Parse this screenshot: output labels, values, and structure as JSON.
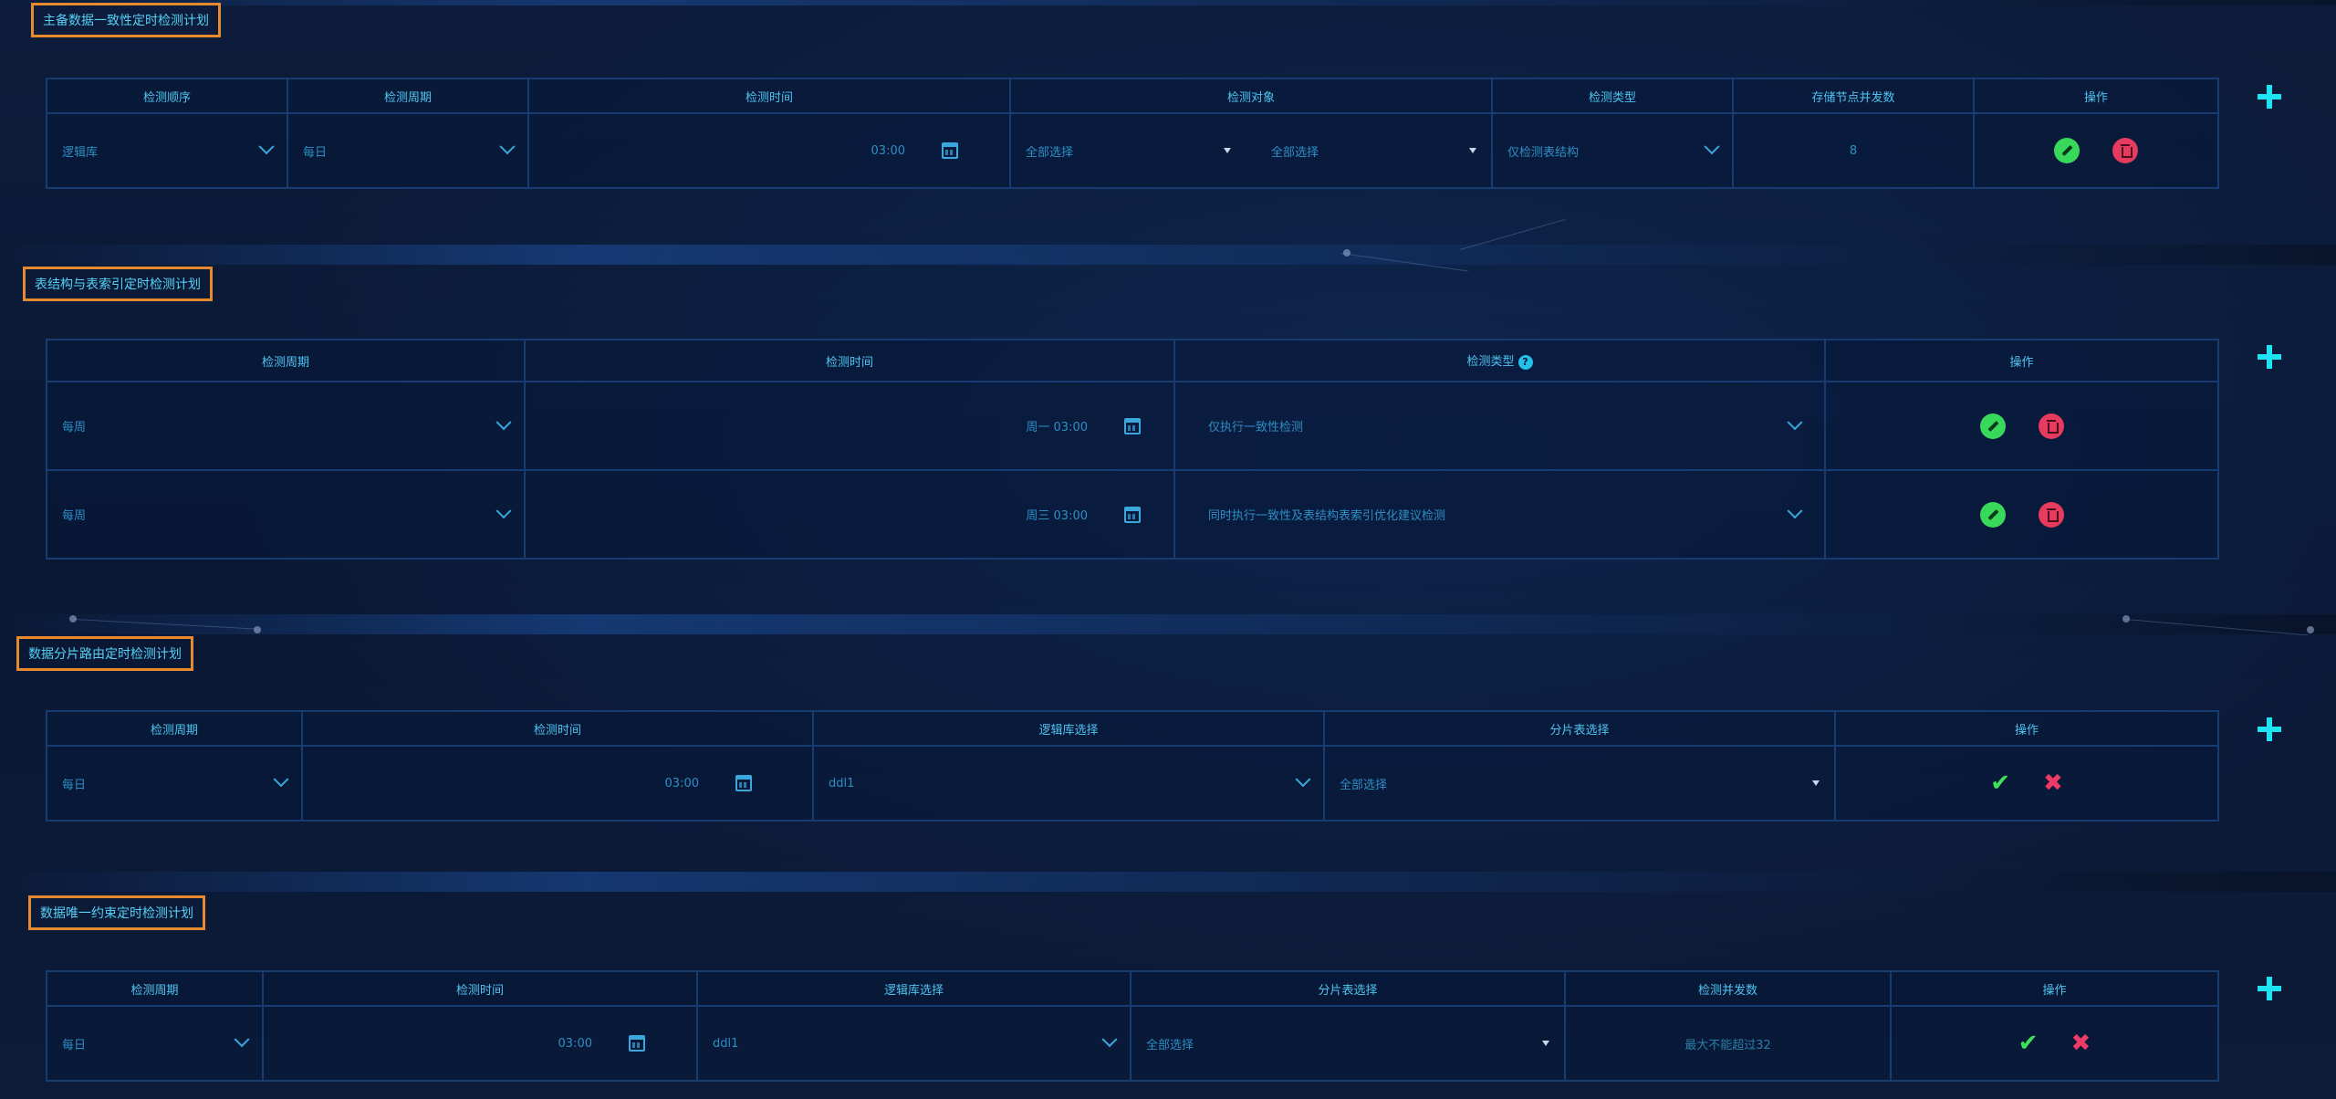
{
  "sections": [
    {
      "title": "主备数据一致性定时检测计划",
      "headers": [
        "检测顺序",
        "检测周期",
        "检测时间",
        "检测对象",
        "检测类型",
        "存储节点并发数",
        "操作"
      ],
      "row": {
        "order": "逻辑库",
        "cycle": "每日",
        "time": "03:00",
        "object_a": "全部选择",
        "object_b": "全部选择",
        "type": "仅检测表结构",
        "concurrency": "8"
      }
    },
    {
      "title": "表结构与表索引定时检测计划",
      "headers": [
        "检测周期",
        "检测时间",
        "检测类型",
        "操作"
      ],
      "help_glyph": "?",
      "rows": [
        {
          "cycle": "每周",
          "time": "周一 03:00",
          "type": "仅执行一致性检测"
        },
        {
          "cycle": "每周",
          "time": "周三 03:00",
          "type": "同时执行一致性及表结构表索引优化建议检测"
        }
      ]
    },
    {
      "title": "数据分片路由定时检测计划",
      "headers": [
        "检测周期",
        "检测时间",
        "逻辑库选择",
        "分片表选择",
        "操作"
      ],
      "row": {
        "cycle": "每日",
        "time": "03:00",
        "db": "ddl1",
        "table": "全部选择"
      }
    },
    {
      "title": "数据唯一约束定时检测计划",
      "headers": [
        "检测周期",
        "检测时间",
        "逻辑库选择",
        "分片表选择",
        "检测并发数",
        "操作"
      ],
      "row": {
        "cycle": "每日",
        "time": "03:00",
        "db": "ddl1",
        "table": "全部选择",
        "concurrency_placeholder": "最大不能超过32"
      }
    }
  ],
  "icons": {
    "add": "plus-icon",
    "edit": "pencil-icon",
    "delete": "trash-icon",
    "confirm": "check-icon",
    "cancel": "x-icon",
    "calendar": "calendar-icon",
    "dropdown": "chevron-down-icon"
  },
  "colors": {
    "background": "#0b1a36",
    "section_border": "#e58a2e",
    "text": "#3fb7e6",
    "plus": "#1ee3f2",
    "edit": "#38d85a",
    "delete": "#e63a5e",
    "confirm": "#3ee05a",
    "cancel": "#ee3a66"
  }
}
